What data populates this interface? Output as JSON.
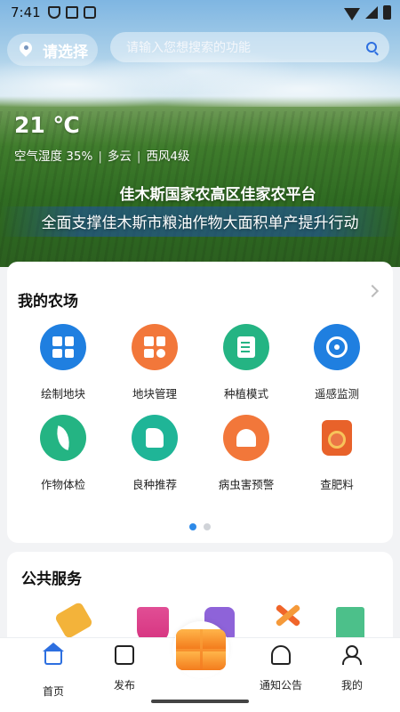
{
  "status_bar": {
    "time": "7:41"
  },
  "header": {
    "location_label": "请选择",
    "search_placeholder": "请输入您想搜索的功能"
  },
  "banner": {
    "temperature": "21 ℃",
    "humidity": "空气湿度 35%",
    "condition": "多云",
    "wind": "西风4级",
    "platform_name": "佳木斯国家农高区佳家农平台",
    "slogan": "全面支撑佳木斯市粮油作物大面积单产提升行动"
  },
  "farm": {
    "title": "我的农场",
    "items": [
      {
        "label": "绘制地块",
        "icon": "map-grid-icon",
        "color": "#1f7fe0"
      },
      {
        "label": "地块管理",
        "icon": "plot-settings-icon",
        "color": "#f2773a"
      },
      {
        "label": "种植模式",
        "icon": "planting-doc-icon",
        "color": "#24b483"
      },
      {
        "label": "遥感监测",
        "icon": "satellite-dish-icon",
        "color": "#1f7fe0"
      },
      {
        "label": "作物体检",
        "icon": "leaf-icon",
        "color": "#24b483"
      },
      {
        "label": "良种推荐",
        "icon": "thumbs-up-icon",
        "color": "#1fb597"
      },
      {
        "label": "病虫害预警",
        "icon": "alarm-bell-icon",
        "color": "#f2773a"
      },
      {
        "label": "查肥料",
        "icon": "fertilizer-bag-icon",
        "color": "#e8622a"
      }
    ],
    "pager": {
      "pages": 2,
      "current": 1
    }
  },
  "public_services": {
    "title": "公共服务",
    "icons": [
      "ruler-pencil-icon",
      "flask-icon",
      "puzzle-icon",
      "tools-icon",
      "book-icon"
    ]
  },
  "tab_bar": {
    "home": "首页",
    "publish": "发布",
    "notice": "通知公告",
    "mine": "我的"
  }
}
